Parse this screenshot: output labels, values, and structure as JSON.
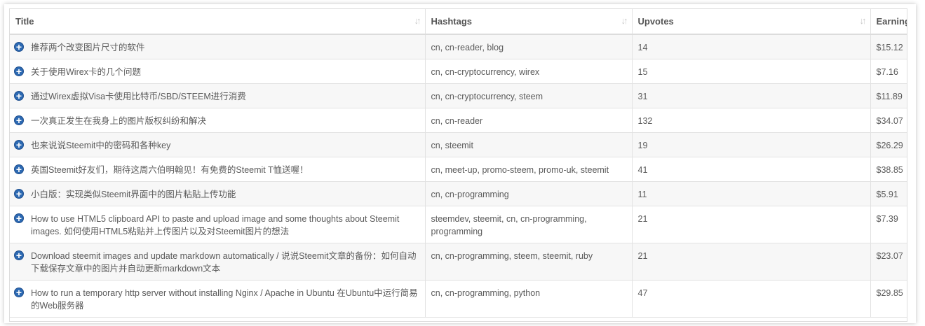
{
  "columns": {
    "title": "Title",
    "hashtags": "Hashtags",
    "upvotes": "Upvotes",
    "earnings": "Earnings"
  },
  "sort_icon": "sort-icon",
  "expand_icon": "plus-circle-icon",
  "rows": [
    {
      "title": "推荐两个改变图片尺寸的软件",
      "hashtags": "cn, cn-reader, blog",
      "upvotes": "14",
      "earnings": "$15.12"
    },
    {
      "title": "关于使用Wirex卡的几个问题",
      "hashtags": "cn, cn-cryptocurrency, wirex",
      "upvotes": "15",
      "earnings": "$7.16"
    },
    {
      "title": "通过Wirex虚拟Visa卡使用比特币/SBD/STEEM进行消费",
      "hashtags": "cn, cn-cryptocurrency, steem",
      "upvotes": "31",
      "earnings": "$11.89"
    },
    {
      "title": "一次真正发生在我身上的图片版权纠纷和解决",
      "hashtags": "cn, cn-reader",
      "upvotes": "132",
      "earnings": "$34.07"
    },
    {
      "title": "也来说说Steemit中的密码和各种key",
      "hashtags": "cn, steemit",
      "upvotes": "19",
      "earnings": "$26.29"
    },
    {
      "title": "英国Steemit好友们，期待这周六伯明翰见！有免费的Steemit T恤送喔！",
      "hashtags": "cn, meet-up, promo-steem, promo-uk, steemit",
      "upvotes": "41",
      "earnings": "$38.85"
    },
    {
      "title": "小白版：实现类似Steemit界面中的图片粘贴上传功能",
      "hashtags": "cn, cn-programming",
      "upvotes": "11",
      "earnings": "$5.91"
    },
    {
      "title": "How to use HTML5 clipboard API to paste and upload image and some thoughts about Steemit images. 如何使用HTML5粘贴并上传图片以及对Steemit图片的想法",
      "hashtags": "steemdev, steemit, cn, cn-programming, programming",
      "upvotes": "21",
      "earnings": "$7.39"
    },
    {
      "title": "Download steemit images and update markdown automatically / 说说Steemit文章的备份：如何自动下载保存文章中的图片并自动更新markdown文本",
      "hashtags": "cn, cn-programming, steem, steemit, ruby",
      "upvotes": "21",
      "earnings": "$23.07"
    },
    {
      "title": "How to run a temporary http server without installing Nginx / Apache in Ubuntu 在Ubuntu中运行简易的Web服务器",
      "hashtags": "cn, cn-programming, python",
      "upvotes": "47",
      "earnings": "$29.85"
    }
  ]
}
